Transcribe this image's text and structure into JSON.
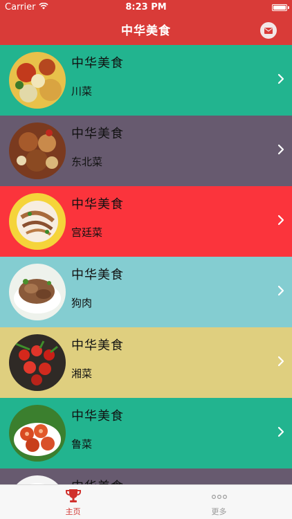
{
  "status_bar": {
    "carrier": "Carrier",
    "time": "8:23 PM"
  },
  "nav": {
    "title": "中华美食",
    "right_icon": "mail-icon"
  },
  "list": {
    "items": [
      {
        "title": "中华美食",
        "subtitle": "川菜",
        "bg": "#22b48f"
      },
      {
        "title": "中华美食",
        "subtitle": "东北菜",
        "bg": "#675a6f"
      },
      {
        "title": "中华美食",
        "subtitle": "宫廷菜",
        "bg": "#fb343c"
      },
      {
        "title": "中华美食",
        "subtitle": "狗肉",
        "bg": "#84cdd1"
      },
      {
        "title": "中华美食",
        "subtitle": "湘菜",
        "bg": "#dfcf7f"
      },
      {
        "title": "中华美食",
        "subtitle": "鲁菜",
        "bg": "#22b48f"
      },
      {
        "title": "中华美食",
        "subtitle": "",
        "bg": "#675a6f"
      }
    ]
  },
  "tabbar": {
    "tabs": [
      {
        "label": "主页",
        "icon": "trophy-icon",
        "active": true
      },
      {
        "label": "更多",
        "icon": "more-dots-icon",
        "active": false
      }
    ]
  },
  "colors": {
    "nav_bg": "#d93b38",
    "tab_active": "#d0312d",
    "tab_inactive": "#9a9a9a"
  }
}
